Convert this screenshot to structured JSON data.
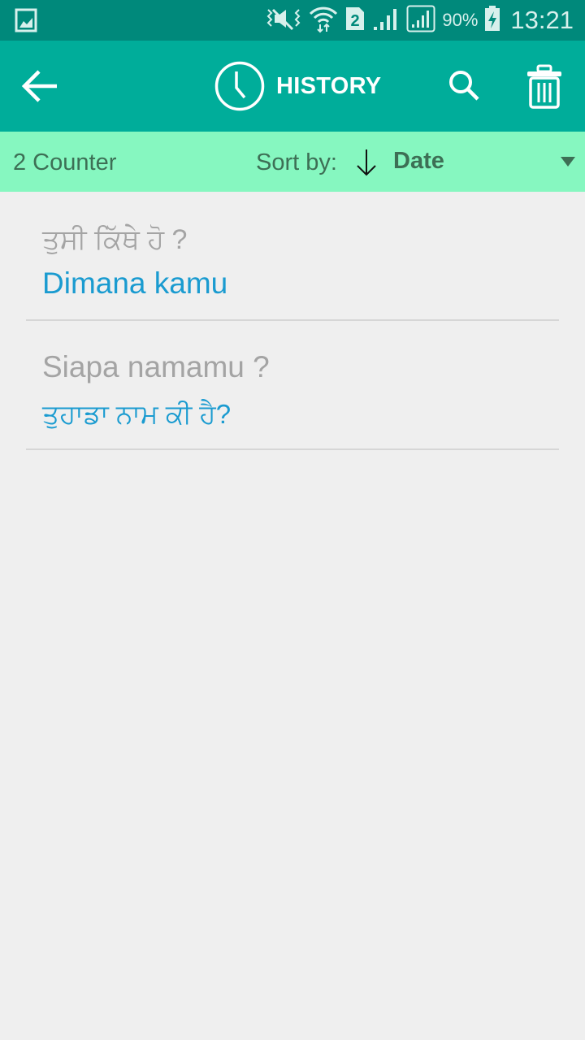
{
  "status_bar": {
    "battery_percent": "90%",
    "time": "13:21",
    "sim_slot": "2",
    "icons": [
      "gallery-notification-icon",
      "mute-vibrate-icon",
      "wifi-icon",
      "sim-2-icon",
      "signal-icon",
      "signal-boxed-icon",
      "battery-charging-icon"
    ]
  },
  "app_bar": {
    "title": "HISTORY",
    "icons": {
      "back": "arrow-left-icon",
      "title": "clock-icon",
      "search": "search-icon",
      "delete": "trash-icon"
    }
  },
  "sort_bar": {
    "counter": "2 Counter",
    "sort_label": "Sort by:",
    "sort_direction": "descending",
    "sort_value": "Date"
  },
  "history": [
    {
      "source": "ਤੁਸੀ ਕਿੱਥੇ ਹੋ ?",
      "translation": "Dimana kamu"
    },
    {
      "source": "Siapa namamu ?",
      "translation": "ਤੁਹਾਡਾ ਨਾਮ ਕੀ ਹੈ?"
    }
  ],
  "colors": {
    "status_bar": "#00897b",
    "app_bar": "#00ad9a",
    "sort_bar": "#86f7c0",
    "translation_text": "#1a9bd0",
    "source_text": "#a4a4a4",
    "background": "#efefef"
  }
}
